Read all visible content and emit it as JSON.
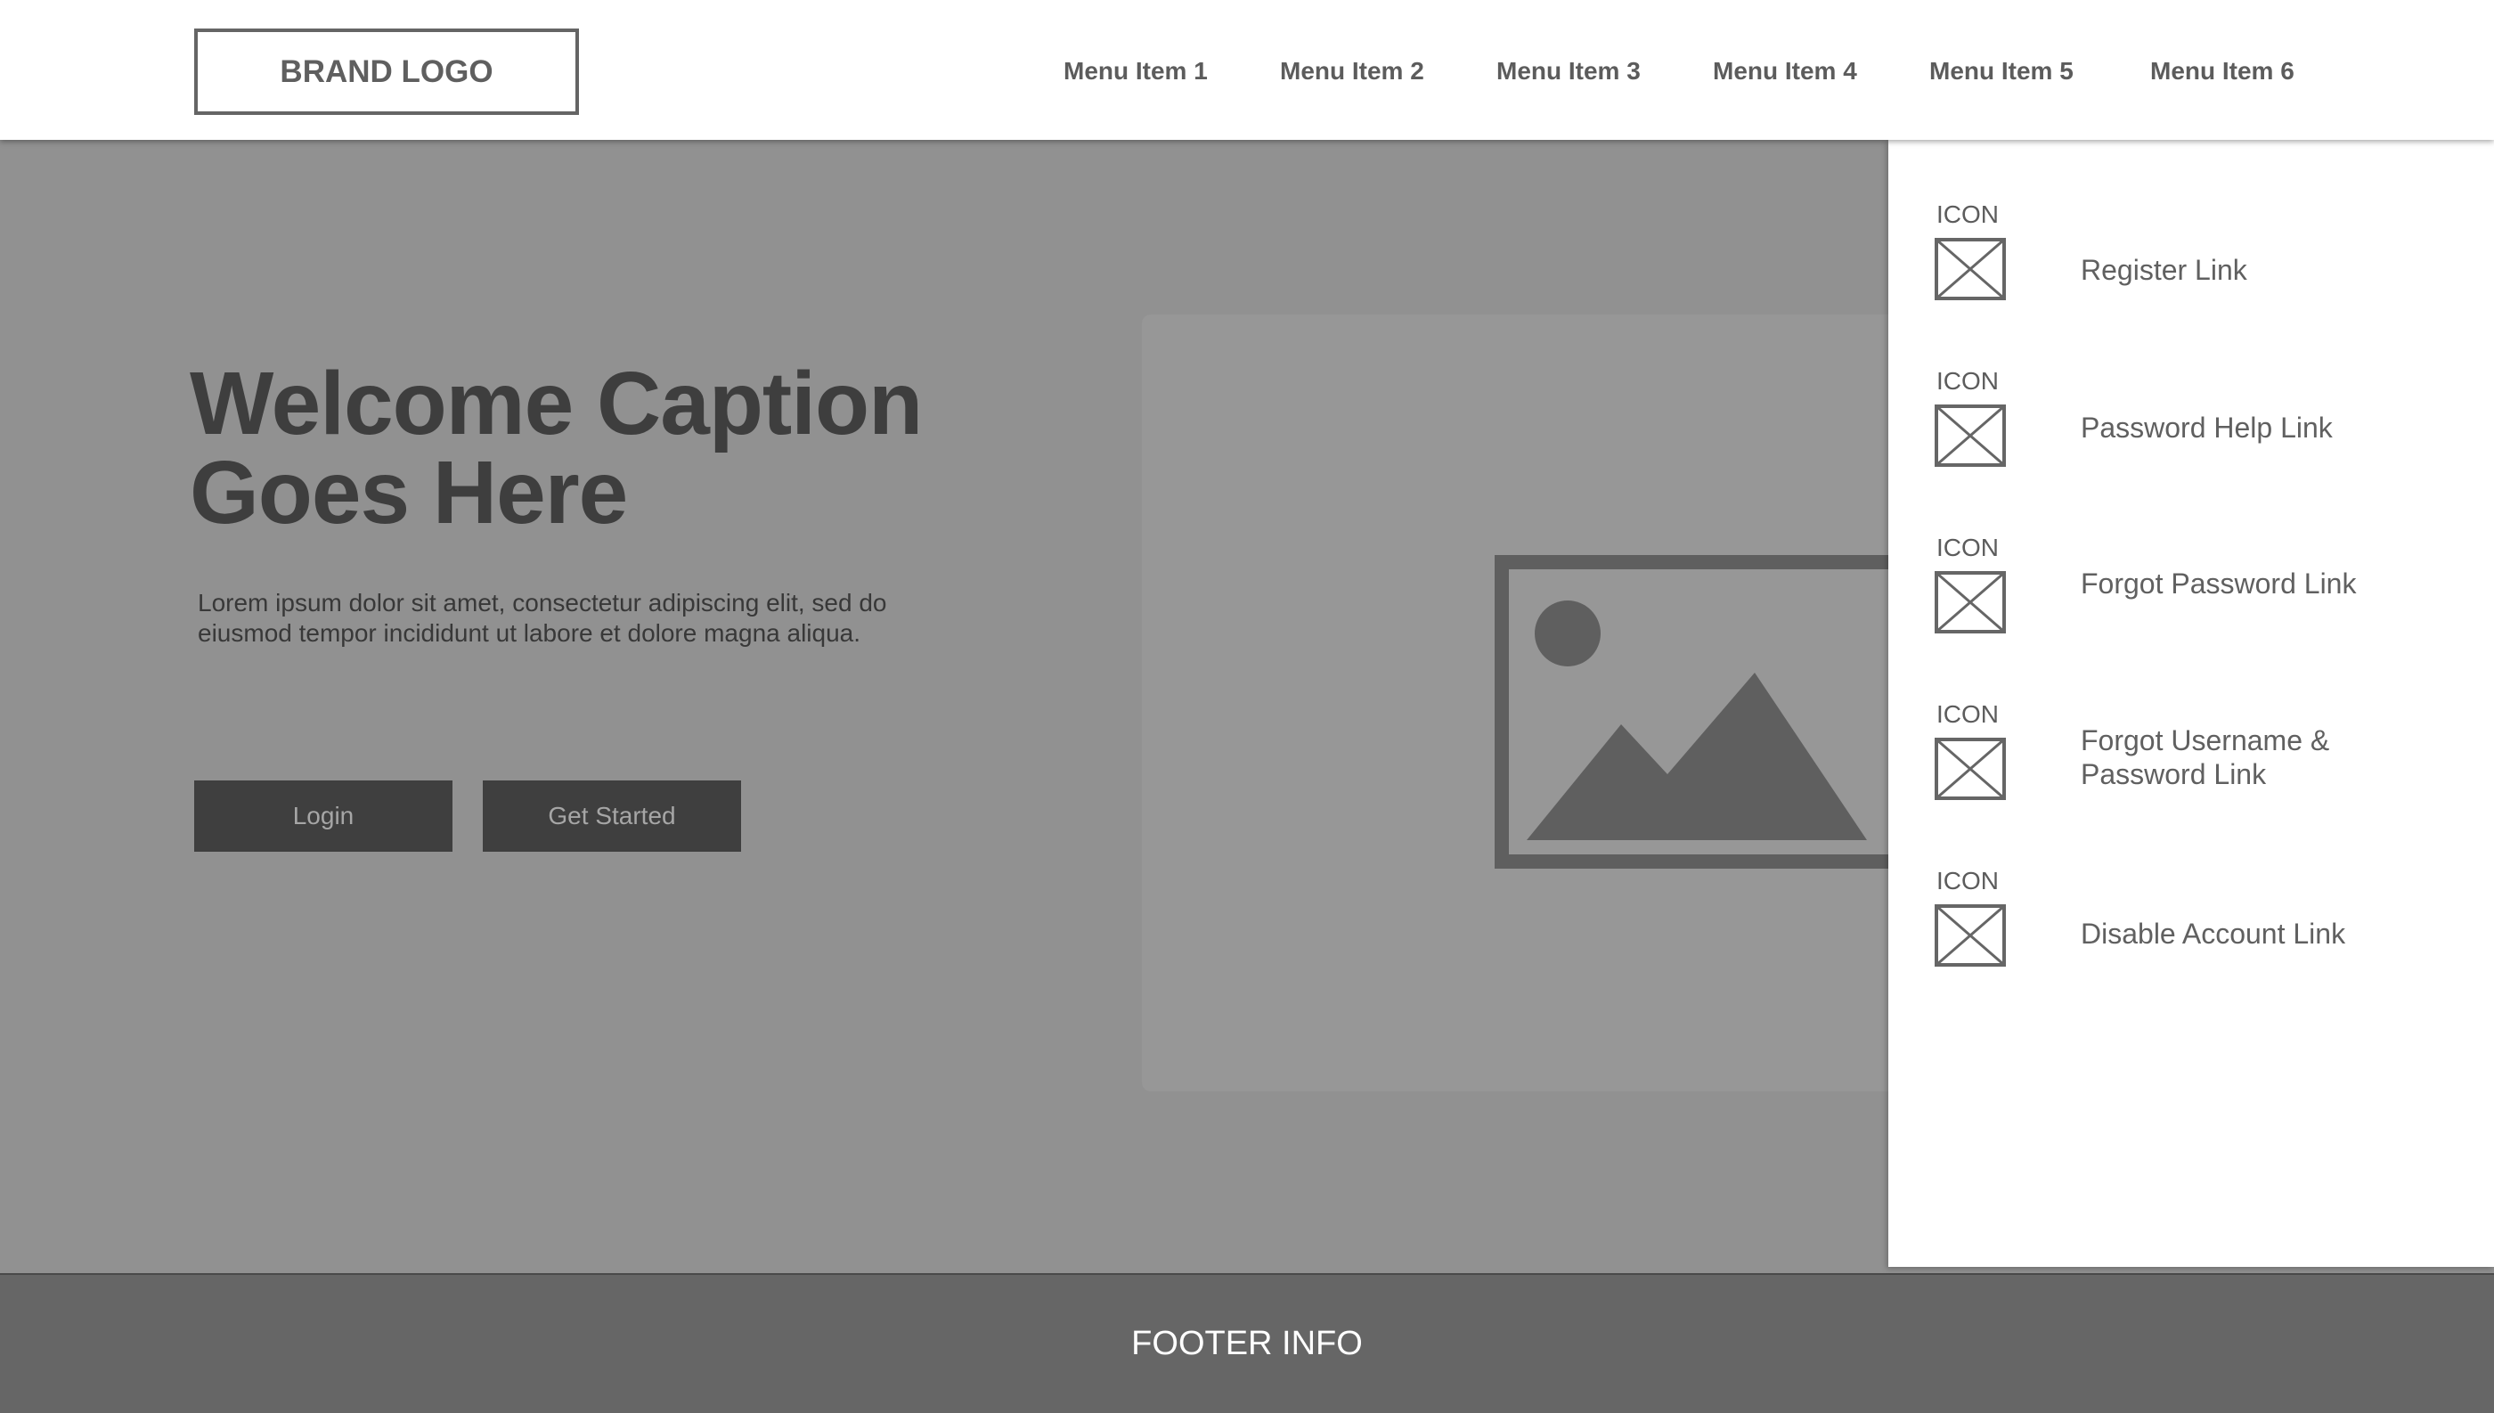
{
  "header": {
    "brand": "BRAND LOGO",
    "menu": [
      "Menu Item 1",
      "Menu Item 2",
      "Menu Item 3",
      "Menu Item 4",
      "Menu Item 5",
      "Menu Item 6"
    ]
  },
  "hero": {
    "headline_line1": "Welcome Caption",
    "headline_line2": "Goes Here",
    "lead_line1": "Lorem ipsum dolor sit amet, consectetur adipiscing elit, sed do",
    "lead_line2": "eiusmod tempor incididunt ut labore et dolore magna aliqua.",
    "login_label": "Login",
    "get_started_label": "Get Started"
  },
  "dropdown": {
    "items": [
      {
        "icon_label": "ICON",
        "link_line1": "Register Link",
        "link_line2": ""
      },
      {
        "icon_label": "ICON",
        "link_line1": "Password Help Link",
        "link_line2": ""
      },
      {
        "icon_label": "ICON",
        "link_line1": "Forgot Password Link",
        "link_line2": ""
      },
      {
        "icon_label": "ICON",
        "link_line1": "Forgot Username &",
        "link_line2": "Password Link"
      },
      {
        "icon_label": "ICON",
        "link_line1": "Disable Account Link",
        "link_line2": ""
      }
    ]
  },
  "footer": {
    "text": "FOOTER INFO"
  },
  "colors": {
    "hero_bg": "#919191",
    "header_bg": "#ffffff",
    "button_bg": "#3f3f3f",
    "footer_bg": "#666666",
    "text_dark": "#3e3e3e"
  },
  "icons": {
    "placeholder": "image-placeholder-icon",
    "link_icon": "crossed-box-icon"
  }
}
